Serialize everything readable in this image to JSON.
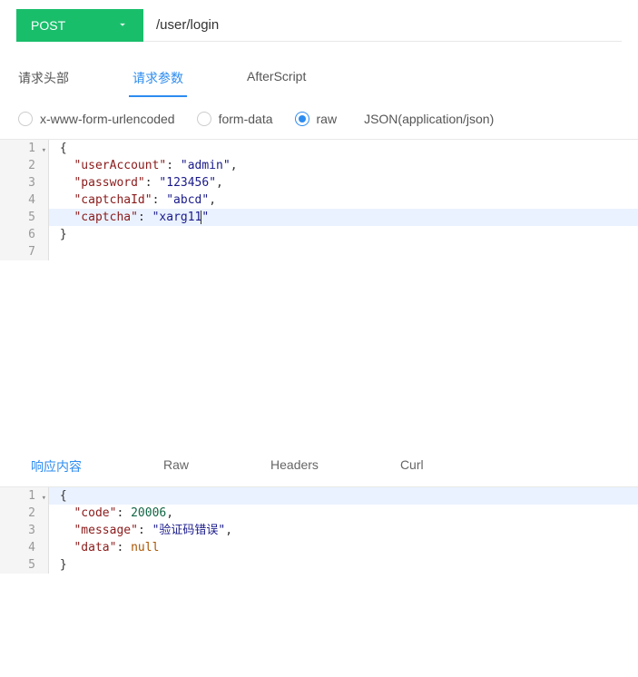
{
  "request": {
    "method": "POST",
    "url": "/user/login"
  },
  "tabs": {
    "headers": "请求头部",
    "params": "请求参数",
    "afterscript": "AfterScript"
  },
  "body_types": {
    "form_url": "x-www-form-urlencoded",
    "form_data": "form-data",
    "raw": "raw",
    "content_type": "JSON(application/json)"
  },
  "request_body": {
    "lines": [
      {
        "n": 1,
        "fold": true,
        "active": false,
        "indent": 0,
        "tokens": [
          {
            "t": "punc",
            "v": "{"
          }
        ]
      },
      {
        "n": 2,
        "active": false,
        "indent": 1,
        "tokens": [
          {
            "t": "key",
            "v": "\"userAccount\""
          },
          {
            "t": "punc",
            "v": ": "
          },
          {
            "t": "str",
            "v": "\"admin\""
          },
          {
            "t": "punc",
            "v": ","
          }
        ]
      },
      {
        "n": 3,
        "active": false,
        "indent": 1,
        "tokens": [
          {
            "t": "key",
            "v": "\"password\""
          },
          {
            "t": "punc",
            "v": ": "
          },
          {
            "t": "str",
            "v": "\"123456\""
          },
          {
            "t": "punc",
            "v": ","
          }
        ]
      },
      {
        "n": 4,
        "active": false,
        "indent": 1,
        "tokens": [
          {
            "t": "key",
            "v": "\"captchaId\""
          },
          {
            "t": "punc",
            "v": ": "
          },
          {
            "t": "str",
            "v": "\"abcd\""
          },
          {
            "t": "punc",
            "v": ","
          }
        ]
      },
      {
        "n": 5,
        "active": true,
        "indent": 1,
        "tokens": [
          {
            "t": "key",
            "v": "\"captcha\""
          },
          {
            "t": "punc",
            "v": ": "
          },
          {
            "t": "str",
            "v": "\"xarg11"
          },
          {
            "t": "cursor",
            "v": ""
          },
          {
            "t": "str",
            "v": "\""
          }
        ]
      },
      {
        "n": 6,
        "active": false,
        "indent": 0,
        "tokens": [
          {
            "t": "punc",
            "v": "}"
          }
        ]
      },
      {
        "n": 7,
        "active": false,
        "indent": 0,
        "tokens": []
      }
    ]
  },
  "response_tabs": {
    "content": "响应内容",
    "raw": "Raw",
    "headers": "Headers",
    "curl": "Curl"
  },
  "response_body": {
    "lines": [
      {
        "n": 1,
        "fold": true,
        "active": true,
        "indent": 0,
        "tokens": [
          {
            "t": "punc",
            "v": "{"
          }
        ]
      },
      {
        "n": 2,
        "active": false,
        "indent": 1,
        "tokens": [
          {
            "t": "key",
            "v": "\"code\""
          },
          {
            "t": "punc",
            "v": ": "
          },
          {
            "t": "num",
            "v": "20006"
          },
          {
            "t": "punc",
            "v": ","
          }
        ]
      },
      {
        "n": 3,
        "active": false,
        "indent": 1,
        "tokens": [
          {
            "t": "key",
            "v": "\"message\""
          },
          {
            "t": "punc",
            "v": ": "
          },
          {
            "t": "str",
            "v": "\"验证码错误\""
          },
          {
            "t": "punc",
            "v": ","
          }
        ]
      },
      {
        "n": 4,
        "active": false,
        "indent": 1,
        "tokens": [
          {
            "t": "key",
            "v": "\"data\""
          },
          {
            "t": "punc",
            "v": ": "
          },
          {
            "t": "null",
            "v": "null"
          }
        ]
      },
      {
        "n": 5,
        "active": false,
        "indent": 0,
        "tokens": [
          {
            "t": "punc",
            "v": "}"
          }
        ]
      }
    ]
  }
}
